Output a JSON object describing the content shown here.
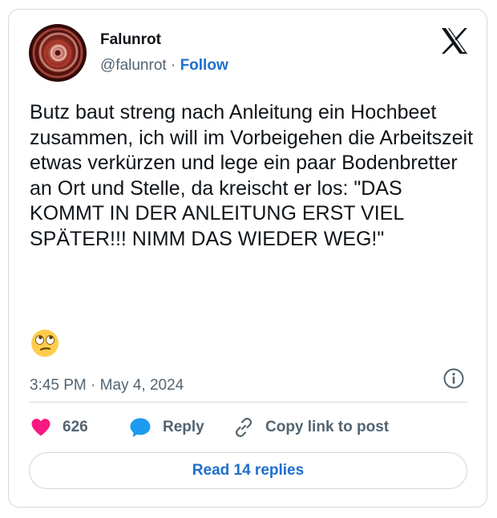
{
  "author": {
    "name": "Falunrot",
    "handle": "@falunrot",
    "separator": "·",
    "follow_label": "Follow"
  },
  "post": {
    "text": "Butz baut streng nach Anleitung ein Hochbeet zusammen, ich will im Vorbeigehen die Arbeitszeit etwas verkürzen und lege ein paar Bodenbretter an Ort und Stelle, da kreischt er los: \"DAS KOMMT IN DER ANLEITUNG ERST VIEL SPÄTER!!! NIMM DAS WIEDER WEG!\"",
    "emoji": "face-with-rolling-eyes",
    "timestamp": "3:45 PM · May 4, 2024"
  },
  "actions": {
    "likes_count": "626",
    "reply_label": "Reply",
    "copy_link_label": "Copy link to post"
  },
  "footer": {
    "read_replies_label": "Read 14 replies"
  },
  "icons": {
    "platform": "x-logo-icon",
    "info": "info-icon",
    "like": "heart-icon",
    "reply": "speech-bubble-icon",
    "copy": "link-icon"
  },
  "colors": {
    "like": "#f91880",
    "reply": "#1d9bf0",
    "link": "#1d6fcd",
    "muted": "#536471"
  }
}
